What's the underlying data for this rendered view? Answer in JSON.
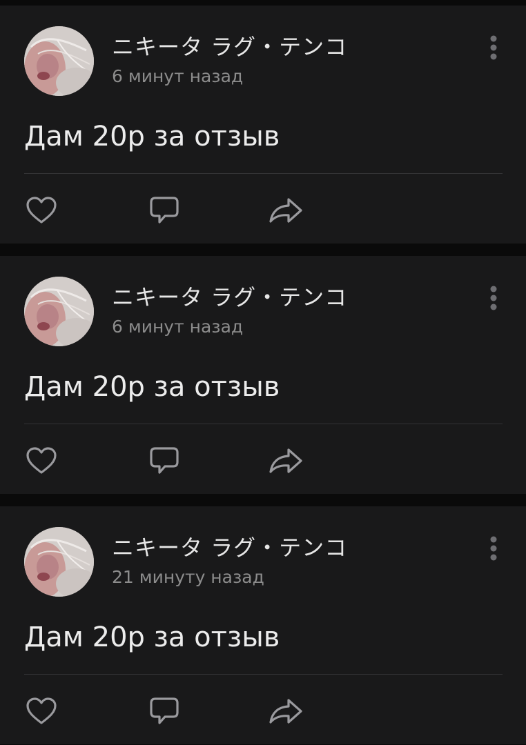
{
  "colors": {
    "background": "#0a0a0a",
    "card": "#19191a",
    "primary_text": "#ececec",
    "secondary_text": "#8c8c8c",
    "icon": "#9a9a9e",
    "divider": "#333335"
  },
  "posts": [
    {
      "author": "ニキータ ラグ・テンコ",
      "time": "6 минут назад",
      "text": "Дам 20р за отзыв",
      "actions": [
        "heart-icon",
        "comment-icon",
        "share-icon"
      ]
    },
    {
      "author": "ニキータ ラグ・テンコ",
      "time": "6 минут назад",
      "text": "Дам 20р за отзыв",
      "actions": [
        "heart-icon",
        "comment-icon",
        "share-icon"
      ]
    },
    {
      "author": "ニキータ ラグ・テンコ",
      "time": "21 минуту назад",
      "text": "Дам 20р за отзыв",
      "actions": [
        "heart-icon",
        "comment-icon",
        "share-icon"
      ]
    }
  ]
}
